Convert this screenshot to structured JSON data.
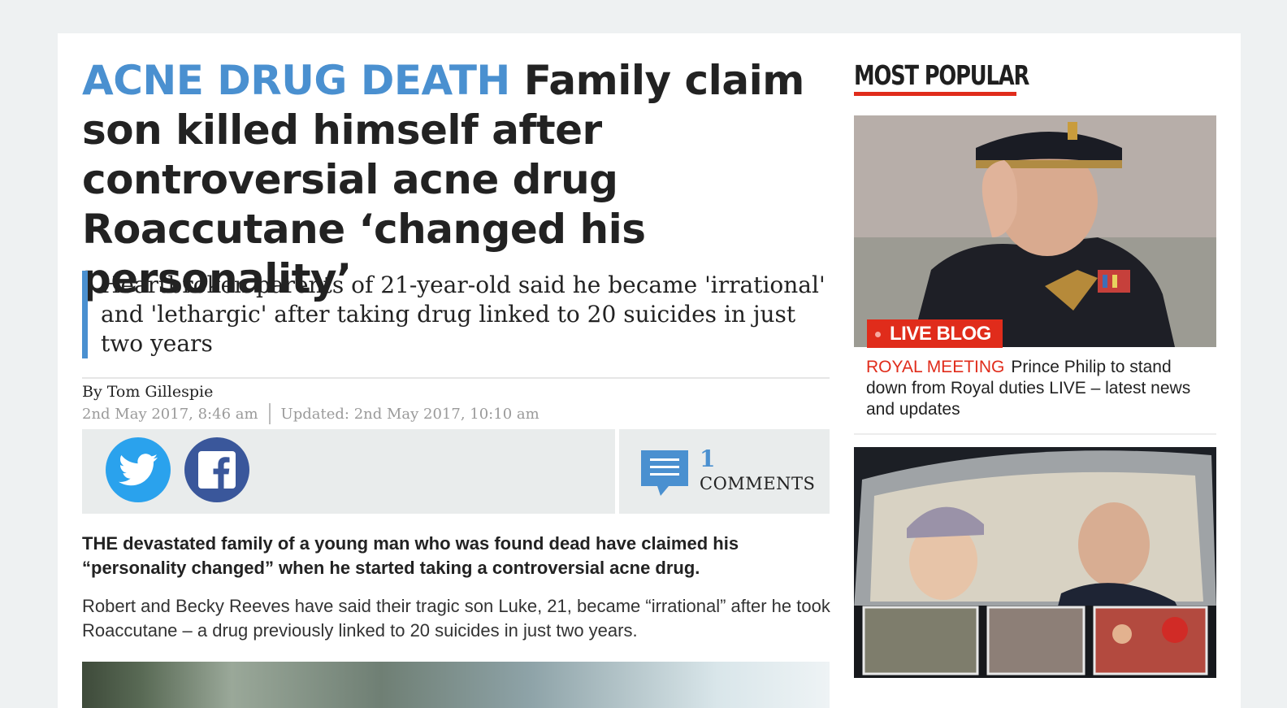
{
  "article": {
    "kicker": "ACNE DRUG DEATH",
    "headline": "Family claim son killed himself after controversial acne drug Roaccutane ‘changed his personality’",
    "standfirst": "Heartbroken parents of 21-year-old said he became 'irrational' and 'lethargic' after taking drug linked to 20 suicides in just two years",
    "byline": "By Tom Gillespie",
    "published": "2nd May 2017, 8:46 am",
    "updated": "Updated: 2nd May 2017, 10:10 am",
    "comments": {
      "count": "1",
      "label": "COMMENTS"
    },
    "lead": "THE devastated family of a young man who was found dead have claimed his “personality changed” when he started taking a controversial acne drug.",
    "paragraph": "Robert and Becky Reeves have said their tragic son Luke, 21, became “irrational” after he took Roaccutane – a drug previously linked to 20 suicides in just two years."
  },
  "share": {
    "twitter_icon": "twitter-icon",
    "facebook_icon": "facebook-icon",
    "comment_icon": "comment-icon"
  },
  "sidebar": {
    "title": "MOST POPULAR",
    "items": [
      {
        "badge": "LIVE BLOG",
        "kicker": "ROYAL MEETING",
        "title": "Prince Philip to stand down from Royal duties LIVE – latest news and updates"
      }
    ]
  },
  "colors": {
    "accent_blue": "#4a90d0",
    "accent_red": "#e02c1b",
    "twitter": "#2aa2ed",
    "facebook": "#3a579b"
  }
}
